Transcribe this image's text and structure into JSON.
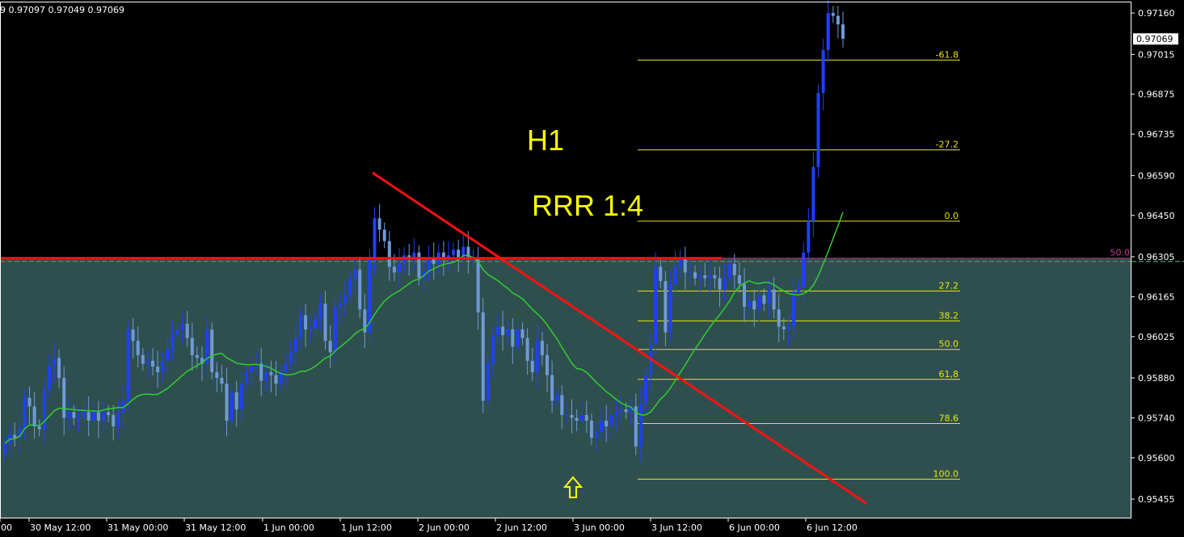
{
  "header": {
    "ohlc_text": "9 0.97097 0.97049 0.97069"
  },
  "annotations": {
    "timeframe": "H1",
    "rrr": "RRR 1:4",
    "level_50_label": "50.0"
  },
  "current_price_label": "0.97069",
  "colors": {
    "background": "#000000",
    "zone_fill": "#2f4f4f",
    "bull_candle": "#1f3fff",
    "bear_candle": "#6f9ad8",
    "ma_line": "#2fcf2f",
    "trendline": "#ff1010",
    "horizontal_level": "#ff1010",
    "fib_lines": "#e8e800",
    "annotation_text": "#ffff00",
    "zone_boundary": "#8a8a6a"
  },
  "icons": {
    "arrow": "up-arrow-icon"
  },
  "chart_data": {
    "type": "candlestick",
    "timeframe": "H1",
    "ylim": [
      0.9539,
      0.972
    ],
    "y_ticks": [
      "0.97160",
      "0.97015",
      "0.96875",
      "0.96735",
      "0.96590",
      "0.96450",
      "0.96305",
      "0.96165",
      "0.96025",
      "0.95880",
      "0.95740",
      "0.95600",
      "0.95455"
    ],
    "x_ticks": [
      "00",
      "30 May 12:00",
      "31 May 00:00",
      "31 May 12:00",
      "1 Jun 00:00",
      "1 Jun 12:00",
      "2 Jun 00:00",
      "2 Jun 12:00",
      "3 Jun 00:00",
      "3 Jun 12:00",
      "6 Jun 00:00",
      "6 Jun 12:00"
    ],
    "close_series": [
      0.9565,
      0.9568,
      0.9567,
      0.957,
      0.9581,
      0.9578,
      0.9571,
      0.957,
      0.9584,
      0.9592,
      0.9595,
      0.9588,
      0.9574,
      0.9576,
      0.9574,
      0.9574,
      0.9576,
      0.9573,
      0.9576,
      0.9573,
      0.9576,
      0.9575,
      0.9571,
      0.9576,
      0.958,
      0.9605,
      0.9601,
      0.9596,
      0.9593,
      0.9594,
      0.9592,
      0.959,
      0.9594,
      0.9598,
      0.9603,
      0.9605,
      0.9607,
      0.9602,
      0.9596,
      0.9595,
      0.9593,
      0.9605,
      0.959,
      0.9588,
      0.9586,
      0.9573,
      0.9583,
      0.9577,
      0.9586,
      0.959,
      0.9592,
      0.9593,
      0.9587,
      0.959,
      0.9589,
      0.9586,
      0.959,
      0.9593,
      0.9597,
      0.9602,
      0.961,
      0.9605,
      0.9605,
      0.9609,
      0.9614,
      0.9601,
      0.9597,
      0.9613,
      0.9614,
      0.9617,
      0.9623,
      0.9626,
      0.9612,
      0.9604,
      0.963,
      0.9644,
      0.964,
      0.9636,
      0.9627,
      0.9625,
      0.9628,
      0.9631,
      0.963,
      0.9632,
      0.9623,
      0.9625,
      0.963,
      0.9628,
      0.9632,
      0.963,
      0.9631,
      0.9633,
      0.963,
      0.9634,
      0.963,
      0.963,
      0.9611,
      0.958,
      0.9593,
      0.9603,
      0.9606,
      0.9603,
      0.9605,
      0.9599,
      0.9605,
      0.9602,
      0.9594,
      0.959,
      0.9601,
      0.9596,
      0.9589,
      0.958,
      0.9582,
      0.9575,
      0.9575,
      0.9574,
      0.9573,
      0.9575,
      0.9573,
      0.9567,
      0.9569,
      0.9573,
      0.9571,
      0.9575,
      0.9576,
      0.9577,
      0.9576,
      0.9578,
      0.9564,
      0.9579,
      0.9589,
      0.96,
      0.9627,
      0.9622,
      0.9604,
      0.9621,
      0.9627,
      0.963,
      0.9625,
      0.9625,
      0.9623,
      0.9624,
      0.9623,
      0.9624,
      0.9623,
      0.9619,
      0.9623,
      0.9628,
      0.9624,
      0.9621,
      0.9613,
      0.9615,
      0.9612,
      0.9617,
      0.9614,
      0.9619,
      0.9612,
      0.9606,
      0.9605,
      0.9606,
      0.9618,
      0.962,
      0.9632,
      0.9643,
      0.9662,
      0.9688,
      0.9703,
      0.9716,
      0.9715,
      0.9712,
      0.9707
    ],
    "levels": {
      "horizontal_resistance": 0.963,
      "zone_upper_boundary": 0.963,
      "trendline": {
        "start_price": 0.966,
        "end_price": 0.9544
      }
    },
    "fibonacci": [
      {
        "label": "-61.8",
        "price": 0.96995
      },
      {
        "label": "-27.2",
        "price": 0.9668
      },
      {
        "label": "0.0",
        "price": 0.9643
      },
      {
        "label": "27.2",
        "price": 0.96185
      },
      {
        "label": "38.2",
        "price": 0.9608
      },
      {
        "label": "50.0",
        "price": 0.9598
      },
      {
        "label": "61,8",
        "price": 0.95875
      },
      {
        "label": "78.6",
        "price": 0.9572
      },
      {
        "label": "100.0",
        "price": 0.95525
      }
    ],
    "moving_average": {
      "color": "#2fcf2f"
    },
    "current_price": 0.97069
  }
}
